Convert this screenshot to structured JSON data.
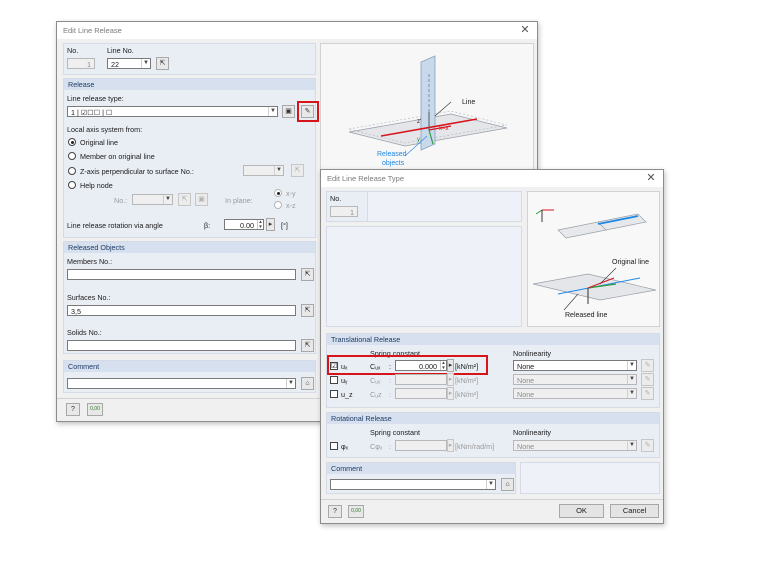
{
  "main_window": {
    "title": "Edit Line Release",
    "no_label": "No.",
    "no_value": "1",
    "line_no_label": "Line No.",
    "line_no_value": "22",
    "release": {
      "header": "Release",
      "type_label": "Line release type:",
      "type_value": "1 | ☑☐☐ | ☐",
      "local_axis_label": "Local axis system from:",
      "options": [
        "Original line",
        "Member on original line",
        "Z-axis perpendicular to surface No.:",
        "Help node"
      ],
      "help_no_label": "No.:",
      "in_plane_label": "In plane:",
      "plane_xy": "x-y",
      "plane_xz": "x-z",
      "rotation_label": "Line release rotation via angle",
      "beta_label": "β:",
      "beta_value": "0.00",
      "beta_unit": "[°]"
    },
    "released_objects": {
      "header": "Released Objects",
      "members_label": "Members No.:",
      "members_value": "",
      "surfaces_label": "Surfaces No.:",
      "surfaces_value": "3,5",
      "solids_label": "Solids No.:",
      "solids_value": ""
    },
    "comment": {
      "header": "Comment",
      "value": ""
    },
    "figure": {
      "line_label": "Line",
      "released_label": "Released",
      "objects_label": "objects",
      "axis_x": "x=x'",
      "axis_y": "y",
      "axis_z": "z'"
    },
    "footer_num_icon": "0,00"
  },
  "release_type_window": {
    "title": "Edit Line Release Type",
    "no_label": "No.",
    "no_value": "1",
    "figure": {
      "original_line_label": "Original line",
      "released_line_label": "Released line"
    },
    "translational": {
      "header": "Translational Release",
      "spring_label": "Spring constant",
      "nonlin_label": "Nonlinearity",
      "rows": [
        {
          "dof": "uₓ",
          "c": "Cᵤₓ",
          "value": "0.000",
          "unit": "[kN/m²]",
          "nonlin": "None",
          "checked": "☑"
        },
        {
          "dof": "uᵧ",
          "c": "Cᵤᵧ",
          "value": "",
          "unit": "[kN/m²]",
          "nonlin": "None",
          "checked": ""
        },
        {
          "dof": "u_z",
          "c": "Cᵤz",
          "value": "",
          "unit": "[kN/m²]",
          "nonlin": "None",
          "checked": ""
        }
      ]
    },
    "rotational": {
      "header": "Rotational Release",
      "spring_label": "Spring constant",
      "nonlin_label": "Nonlinearity",
      "dof": "φₓ",
      "c": "Cφₓ",
      "unit": "[kNm/rad/m]",
      "nonlin": "None"
    },
    "comment": {
      "header": "Comment",
      "value": ""
    },
    "ok_label": "OK",
    "cancel_label": "Cancel",
    "footer_num_icon": "0,00"
  },
  "colors": {
    "highlight": "#d7141a",
    "group_header": "#d6e0ee",
    "accent_blue": "#1e88e5",
    "axis_green": "#2e9b3e",
    "axis_red": "#d7141a"
  }
}
